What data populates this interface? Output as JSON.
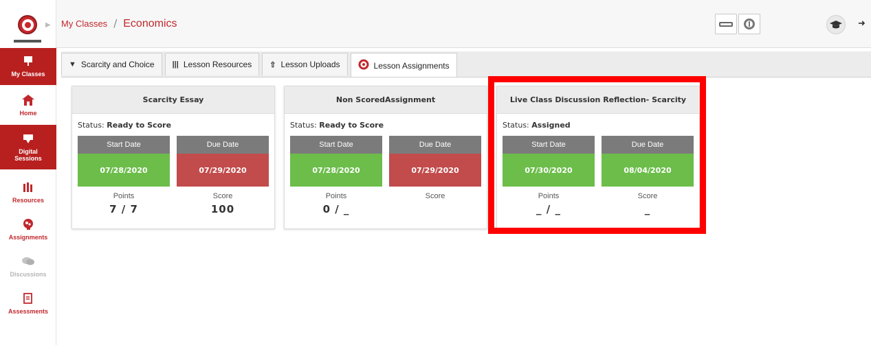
{
  "header": {
    "breadcrumb_link": "My Classes",
    "breadcrumb_sep": "/",
    "page_title": "Economics"
  },
  "sidebar": {
    "items": [
      {
        "label": "My Classes",
        "icon": "presentation-board-icon",
        "state": "active"
      },
      {
        "label": "Home",
        "icon": "home-icon",
        "state": "normal"
      },
      {
        "label": "Digital Sessions",
        "icon": "chalkboard-icon",
        "state": "active"
      },
      {
        "label": "Resources",
        "icon": "books-icon",
        "state": "normal"
      },
      {
        "label": "Assignments",
        "icon": "brain-gear-icon",
        "state": "normal"
      },
      {
        "label": "Discussions",
        "icon": "chat-bubbles-icon",
        "state": "disabled"
      },
      {
        "label": "Assessments",
        "icon": "clipboard-pencil-icon",
        "state": "normal"
      }
    ]
  },
  "tabs": [
    {
      "label": "Scarcity and Choice",
      "icon": "chalkboard-icon"
    },
    {
      "label": "Lesson Resources",
      "icon": "books-icon"
    },
    {
      "label": "Lesson Uploads",
      "icon": "upload-icon"
    },
    {
      "label": "Lesson Assignments",
      "icon": "brain-gear-icon",
      "selected": true
    }
  ],
  "labels": {
    "status": "Status:",
    "start_date": "Start Date",
    "due_date": "Due Date",
    "points": "Points",
    "score": "Score"
  },
  "cards": [
    {
      "title": "Scarcity Essay",
      "status": "Ready to Score",
      "start": "07/28/2020",
      "due": "07/29/2020",
      "points": "7 / 7",
      "score": "100"
    },
    {
      "title": "Non ScoredAssignment",
      "status": "Ready to Score",
      "start": "07/28/2020",
      "due": "07/29/2020",
      "points": "0 / _",
      "score": ""
    },
    {
      "title": "Live Class Discussion Reflection- Scarcity",
      "status": "Assigned",
      "start": "07/30/2020",
      "due": "08/04/2020",
      "points": "_ / _",
      "score": "_"
    }
  ],
  "colors": {
    "brand_red": "#c0282d",
    "date_green": "#6cbd4a",
    "date_red": "#c24b4b",
    "highlight": "#ff0000"
  }
}
